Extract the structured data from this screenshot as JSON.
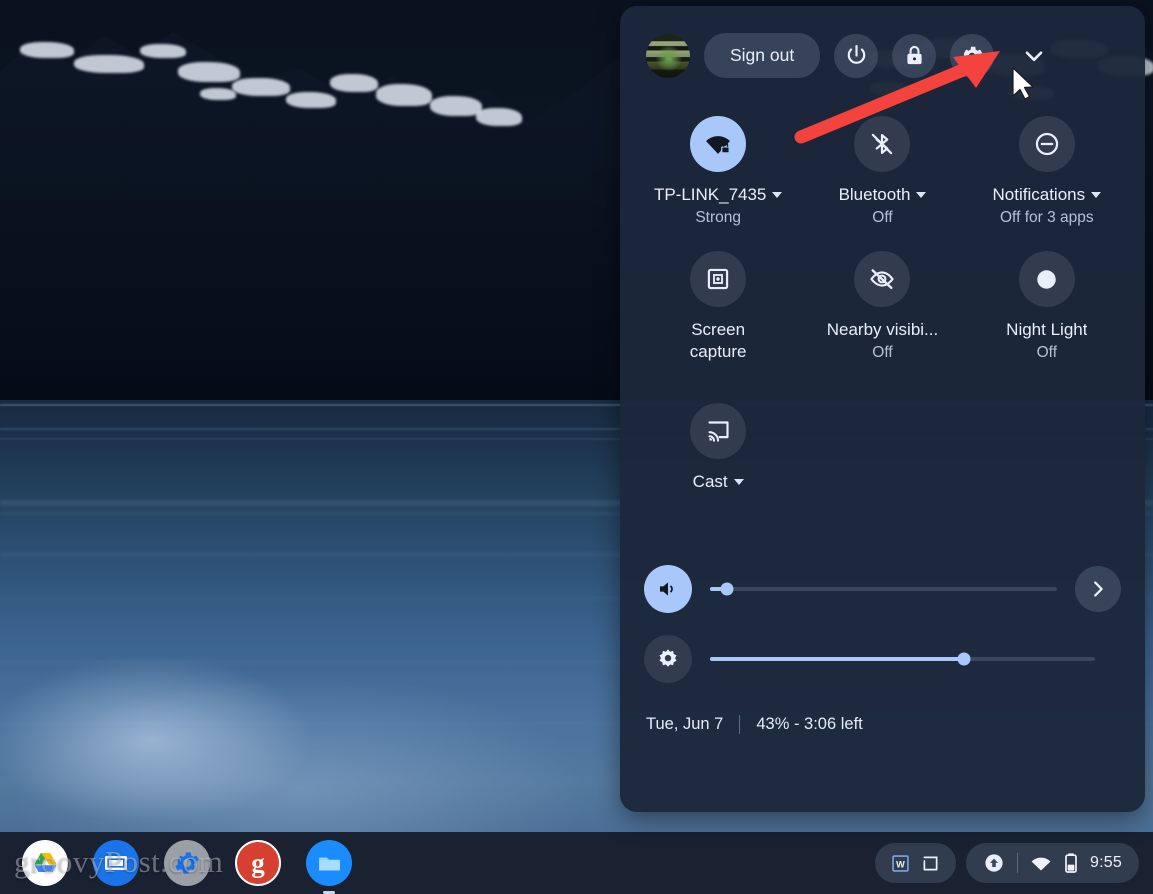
{
  "desktop": {
    "wallpaper_description": "dark mountain lake at dusk"
  },
  "watermark": {
    "text": "groovyPost.com"
  },
  "quick_settings": {
    "header": {
      "avatar": "user-avatar",
      "sign_out_label": "Sign out",
      "power_icon": "power-icon",
      "lock_icon": "lock-icon",
      "settings_icon": "gear-icon",
      "collapse_icon": "chevron-down-icon"
    },
    "tiles": [
      {
        "icon": "wifi-locked-icon",
        "label": "TP-LINK_7435",
        "sub": "Strong",
        "has_caret": true,
        "active": true
      },
      {
        "icon": "bluetooth-off-icon",
        "label": "Bluetooth",
        "sub": "Off",
        "has_caret": true,
        "active": false
      },
      {
        "icon": "do-not-disturb-icon",
        "label": "Notifications",
        "sub": "Off for 3 apps",
        "has_caret": true,
        "active": false
      },
      {
        "icon": "screen-capture-icon",
        "label": "Screen capture",
        "sub": "",
        "has_caret": false,
        "active": false
      },
      {
        "icon": "nearby-visibility-off-icon",
        "label": "Nearby visibi...",
        "sub": "Off",
        "has_caret": false,
        "active": false
      },
      {
        "icon": "night-light-icon",
        "label": "Night Light",
        "sub": "Off",
        "has_caret": false,
        "active": false
      },
      {
        "icon": "cast-icon",
        "label": "Cast",
        "sub": "",
        "has_caret": true,
        "active": false
      }
    ],
    "volume_slider": {
      "icon": "volume-icon",
      "value": 5,
      "next_icon": "chevron-right-icon"
    },
    "brightness_slider": {
      "icon": "brightness-icon",
      "value": 66
    },
    "footer": {
      "date": "Tue, Jun 7",
      "battery": "43% - 3:06 left"
    }
  },
  "shelf": {
    "apps": [
      {
        "name": "google-drive-app",
        "color": "#ffffff"
      },
      {
        "name": "slides-app",
        "color": "#1a73e8"
      },
      {
        "name": "settings-app",
        "color": "#9aa0a6"
      },
      {
        "name": "groovypost-app",
        "color": "#d64030"
      },
      {
        "name": "files-app",
        "color": "#1a8cff"
      }
    ],
    "tray": {
      "word_icon": "word-doc-icon",
      "window_icon": "window-icon",
      "upload_icon": "upload-status-icon",
      "wifi_icon": "wifi-icon",
      "battery_icon": "battery-icon",
      "time": "9:55"
    }
  },
  "annotation": {
    "arrow_color": "#f4433c",
    "points_to": "gear-icon",
    "cursor": "mouse-pointer"
  },
  "colors": {
    "panel_bg": "#1d273b",
    "tile_bg": "#333c4e",
    "accent": "#a8c7fa",
    "text": "#e9eefa",
    "subtext": "#b6c1d4",
    "shelf_bg": "#1c2434"
  }
}
